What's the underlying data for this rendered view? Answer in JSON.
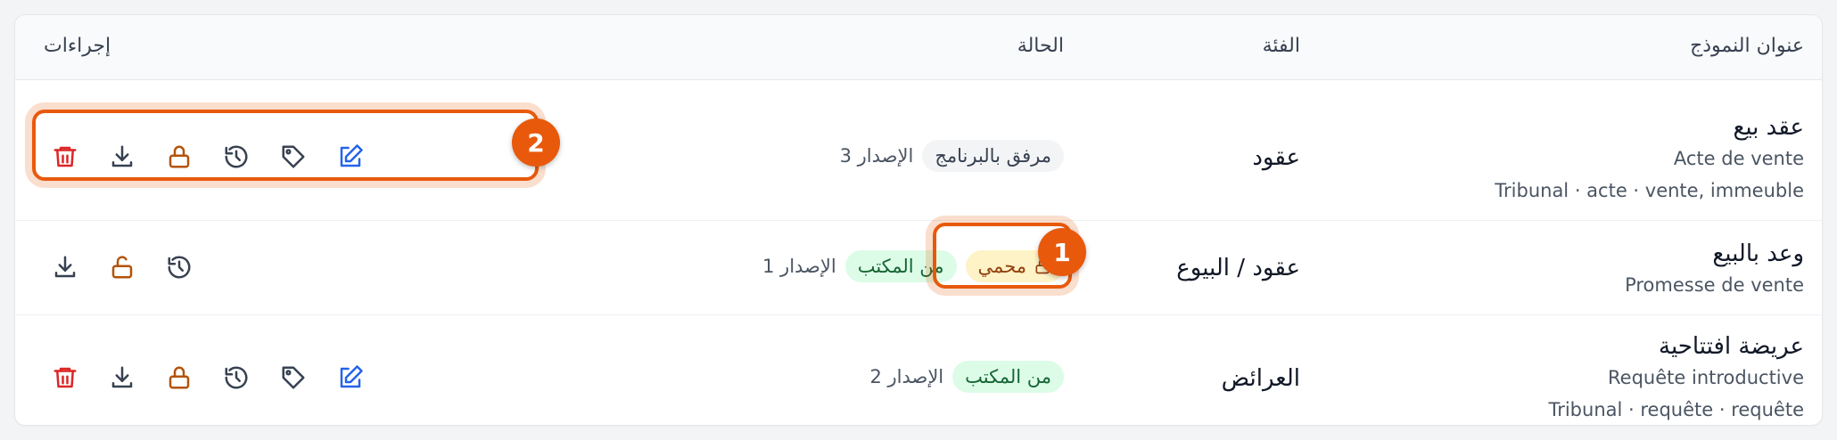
{
  "table": {
    "headers": {
      "title": "عنوان النموذج",
      "category": "الفئة",
      "status": "الحالة",
      "actions": "إجراءات"
    },
    "rows": [
      {
        "title": "عقد بيع",
        "subtitle": "Acte de vente",
        "meta": "Tribunal · acte · vente, immeuble",
        "category": "عقود",
        "status_pill": "مرفق بالبرنامج",
        "version": "الإصدار 3",
        "actions": [
          "edit-icon",
          "tag-icon",
          "history-icon",
          "lock-icon",
          "download-icon",
          "delete-icon"
        ]
      },
      {
        "title": "وعد بالبيع",
        "subtitle": "Promesse de vente",
        "category": "عقود / البيوع",
        "protected_pill": "محمي",
        "status_pill": "من المكتب",
        "version": "الإصدار 1",
        "actions": [
          "history-icon",
          "unlock-icon",
          "download-icon"
        ]
      },
      {
        "title": "عريضة افتتاحية",
        "subtitle": "Requête introductive",
        "meta": "Tribunal · requête · requête",
        "category": "العرائض",
        "status_pill": "من المكتب",
        "version": "الإصدار 2",
        "actions": [
          "edit-icon",
          "tag-icon",
          "history-icon",
          "lock-icon",
          "download-icon",
          "delete-icon"
        ]
      }
    ]
  },
  "annotations": {
    "badge1": "1",
    "badge2": "2",
    "color": "#e8590c"
  },
  "colors": {
    "edit": "#2563eb",
    "lock": "#b45309",
    "delete": "#dc2626",
    "neutral": "#374151"
  }
}
